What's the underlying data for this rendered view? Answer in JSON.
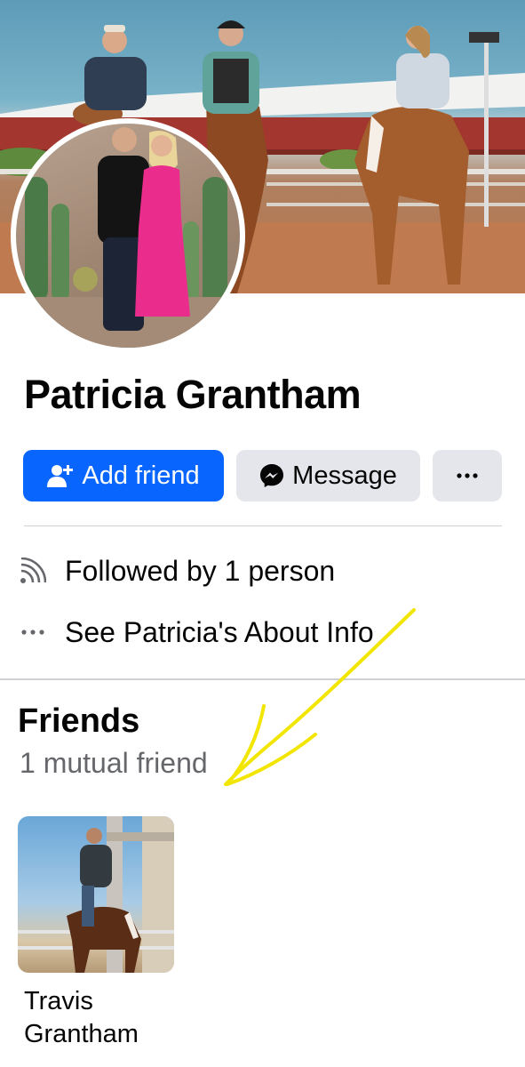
{
  "profile": {
    "name": "Patricia Grantham",
    "cover_photo": "horse-riders-cover-photo",
    "profile_photo": "couple-profile-photo"
  },
  "actions": {
    "add_friend_label": "Add friend",
    "add_friend_icon": "add-person-icon",
    "message_label": "Message",
    "message_icon": "messenger-icon",
    "more_icon": "more-dots-icon"
  },
  "info": {
    "followed_by": "Followed by 1 person",
    "followed_icon": "rss-feed-icon",
    "about": "See Patricia's About Info",
    "about_icon": "more-dots-icon"
  },
  "friends": {
    "title": "Friends",
    "subtitle": "1 mutual friend",
    "list": [
      {
        "name": "Travis Grantham",
        "photo": "man-on-horse-photo"
      }
    ]
  },
  "colors": {
    "primary_blue": "#0866ff",
    "secondary_button": "#e4e6eb",
    "annotation_yellow": "#f2e600",
    "secondary_text": "#65676b"
  }
}
